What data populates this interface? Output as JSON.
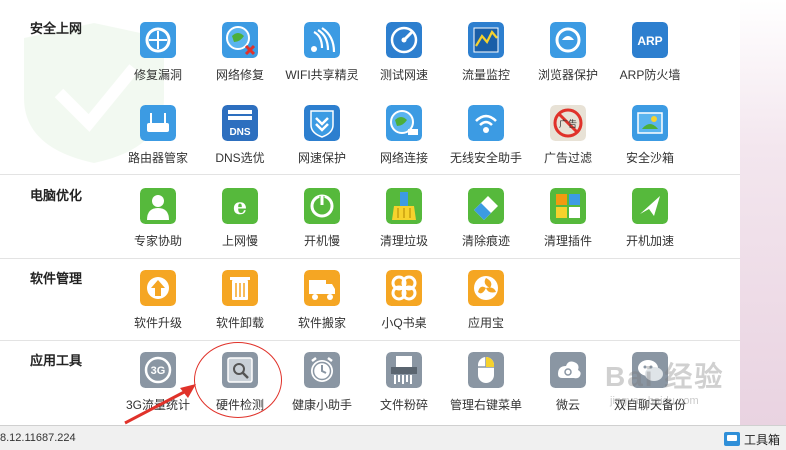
{
  "sections": [
    {
      "title": "安全上网",
      "tools": [
        {
          "label": "修复漏洞",
          "icon": "repair-vulnerability-icon"
        },
        {
          "label": "网络修复",
          "icon": "network-repair-icon"
        },
        {
          "label": "WIFI共享精灵",
          "icon": "wifi-share-icon"
        },
        {
          "label": "测试网速",
          "icon": "speed-test-icon"
        },
        {
          "label": "流量监控",
          "icon": "traffic-monitor-icon"
        },
        {
          "label": "浏览器保护",
          "icon": "browser-protect-icon"
        },
        {
          "label": "ARP防火墙",
          "icon": "arp-firewall-icon"
        },
        {
          "label": "路由器管家",
          "icon": "router-manager-icon"
        },
        {
          "label": "DNS选优",
          "icon": "dns-optimize-icon"
        },
        {
          "label": "网速保护",
          "icon": "speed-protect-icon"
        },
        {
          "label": "网络连接",
          "icon": "network-connection-icon"
        },
        {
          "label": "无线安全助手",
          "icon": "wireless-security-icon"
        },
        {
          "label": "广告过滤",
          "icon": "ad-filter-icon"
        },
        {
          "label": "安全沙箱",
          "icon": "security-sandbox-icon"
        }
      ]
    },
    {
      "title": "电脑优化",
      "tools": [
        {
          "label": "专家协助",
          "icon": "expert-assist-icon"
        },
        {
          "label": "上网慢",
          "icon": "slow-internet-icon"
        },
        {
          "label": "开机慢",
          "icon": "slow-boot-icon"
        },
        {
          "label": "清理垃圾",
          "icon": "clean-junk-icon"
        },
        {
          "label": "清除痕迹",
          "icon": "clear-traces-icon"
        },
        {
          "label": "清理插件",
          "icon": "clean-plugins-icon"
        },
        {
          "label": "开机加速",
          "icon": "boot-speedup-icon"
        }
      ]
    },
    {
      "title": "软件管理",
      "tools": [
        {
          "label": "软件升级",
          "icon": "software-upgrade-icon"
        },
        {
          "label": "软件卸载",
          "icon": "software-uninstall-icon"
        },
        {
          "label": "软件搬家",
          "icon": "software-move-icon"
        },
        {
          "label": "小Q书桌",
          "icon": "q-desk-icon"
        },
        {
          "label": "应用宝",
          "icon": "app-store-icon"
        }
      ]
    },
    {
      "title": "应用工具",
      "tools": [
        {
          "label": "3G流量统计",
          "icon": "3g-traffic-icon",
          "icon_text": "3G"
        },
        {
          "label": "硬件检测",
          "icon": "hardware-detect-icon"
        },
        {
          "label": "健康小助手",
          "icon": "health-assistant-icon"
        },
        {
          "label": "文件粉碎",
          "icon": "file-shredder-icon"
        },
        {
          "label": "管理右键菜单",
          "icon": "right-click-menu-icon"
        },
        {
          "label": "微云",
          "icon": "weiyun-icon"
        },
        {
          "label": "双自聊天备份",
          "icon": "chat-backup-icon"
        }
      ]
    }
  ],
  "icon_texts": {
    "arp": "ARP",
    "dns": "DNS",
    "ad": "广告",
    "threeg": "3G"
  },
  "status": {
    "version": "8.12.11687.224",
    "toolbox_label": "工具箱"
  },
  "watermark": {
    "brand": "Bai 经验",
    "url": "jingyan.baidu.com"
  },
  "colors": {
    "accent": "#2a86d4",
    "annotation": "#e0322a"
  }
}
